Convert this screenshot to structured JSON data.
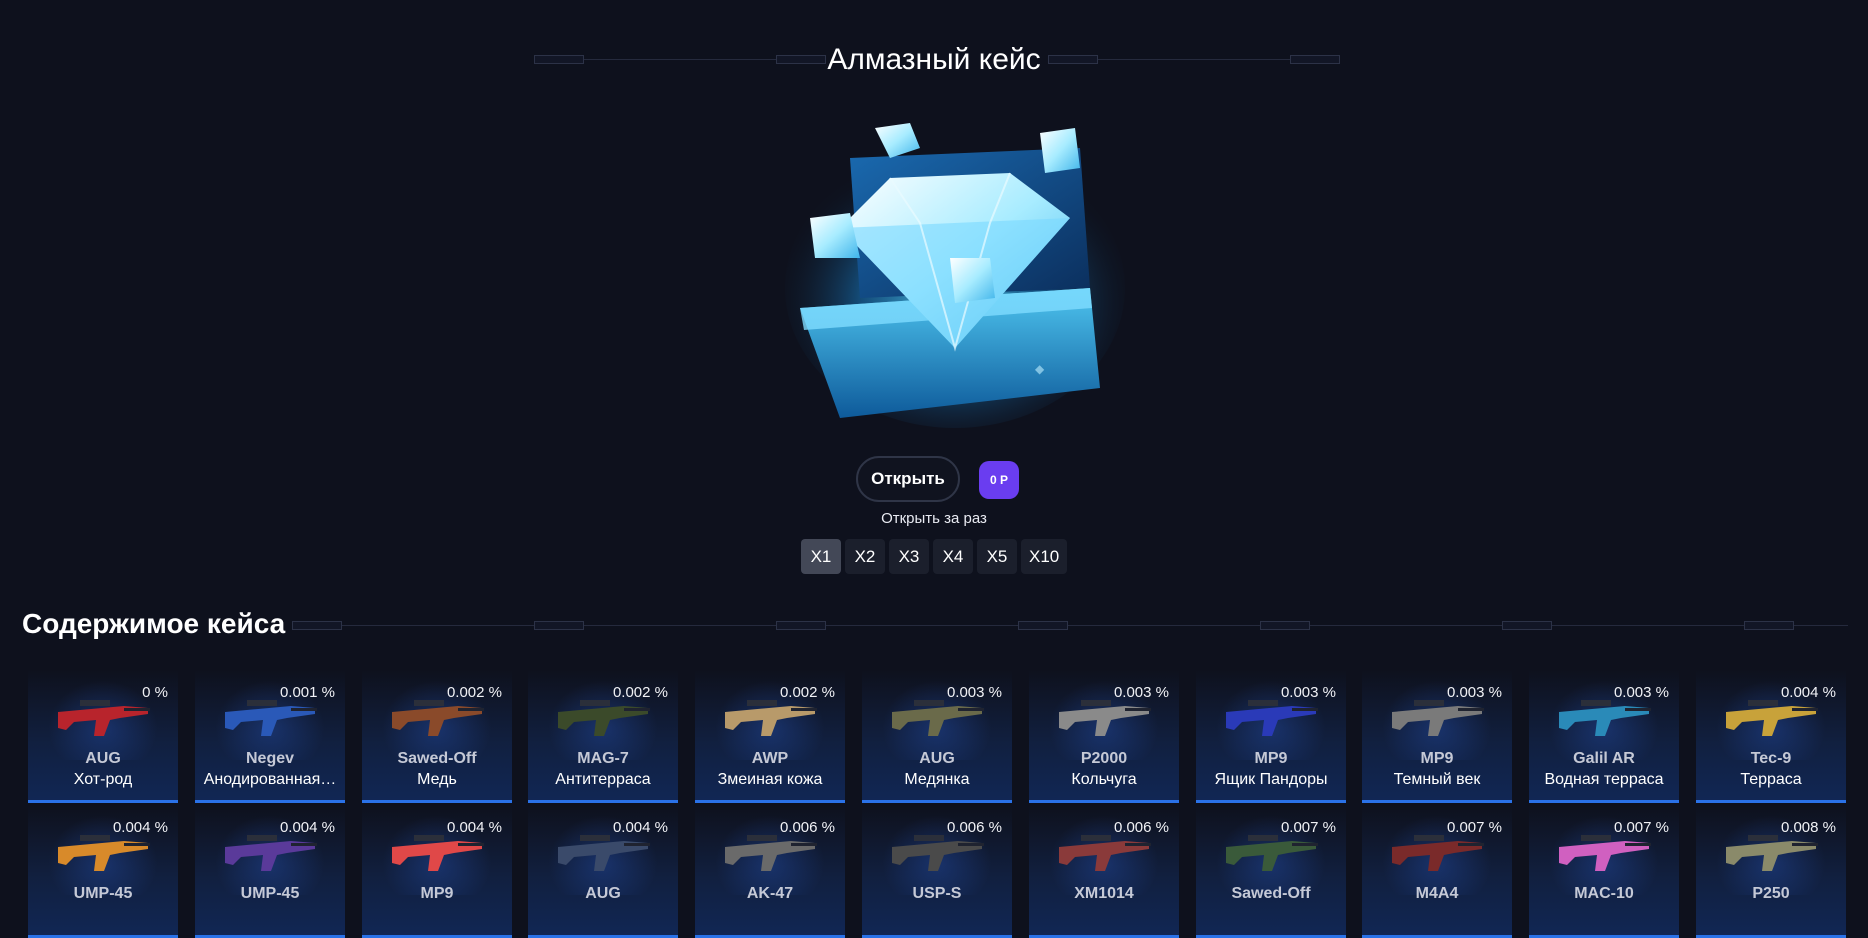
{
  "case": {
    "title": "Алмазный кейс",
    "open_label": "Открыть",
    "price_label": "0 Р",
    "open_times_label": "Открыть за раз",
    "multipliers": [
      "X1",
      "X2",
      "X3",
      "X4",
      "X5",
      "X10"
    ],
    "selected_multiplier": "X1"
  },
  "contents": {
    "title": "Содержимое кейса",
    "items": [
      {
        "weapon": "AUG",
        "skin": "Хот-род",
        "chance": "0 %",
        "color": "#b8242c"
      },
      {
        "weapon": "Negev",
        "skin": "Анодированная…",
        "chance": "0.001 %",
        "color": "#2a59b8"
      },
      {
        "weapon": "Sawed-Off",
        "skin": "Медь",
        "chance": "0.002 %",
        "color": "#8a4a2a"
      },
      {
        "weapon": "MAG-7",
        "skin": "Антитерраса",
        "chance": "0.002 %",
        "color": "#3b4a2a"
      },
      {
        "weapon": "AWP",
        "skin": "Змеиная кожа",
        "chance": "0.002 %",
        "color": "#b89a6a"
      },
      {
        "weapon": "AUG",
        "skin": "Медянка",
        "chance": "0.003 %",
        "color": "#6a6a4a"
      },
      {
        "weapon": "P2000",
        "skin": "Кольчуга",
        "chance": "0.003 %",
        "color": "#8a8a8a"
      },
      {
        "weapon": "MP9",
        "skin": "Ящик Пандоры",
        "chance": "0.003 %",
        "color": "#2a3ab8"
      },
      {
        "weapon": "MP9",
        "skin": "Темный век",
        "chance": "0.003 %",
        "color": "#7a7a7a"
      },
      {
        "weapon": "Galil AR",
        "skin": "Водная терраса",
        "chance": "0.003 %",
        "color": "#2a8ab8"
      },
      {
        "weapon": "Tec-9",
        "skin": "Терраса",
        "chance": "0.004 %",
        "color": "#c8a23a"
      },
      {
        "weapon": "UMP-45",
        "skin": "",
        "chance": "0.004 %",
        "color": "#d88a2a"
      },
      {
        "weapon": "UMP-45",
        "skin": "",
        "chance": "0.004 %",
        "color": "#5a3a9a"
      },
      {
        "weapon": "MP9",
        "skin": "",
        "chance": "0.004 %",
        "color": "#e04848"
      },
      {
        "weapon": "AUG",
        "skin": "",
        "chance": "0.004 %",
        "color": "#3a4a6a"
      },
      {
        "weapon": "AK-47",
        "skin": "",
        "chance": "0.006 %",
        "color": "#6a6a6a"
      },
      {
        "weapon": "USP-S",
        "skin": "",
        "chance": "0.006 %",
        "color": "#4a4a4a"
      },
      {
        "weapon": "XM1014",
        "skin": "",
        "chance": "0.006 %",
        "color": "#8a3a3a"
      },
      {
        "weapon": "Sawed-Off",
        "skin": "",
        "chance": "0.007 %",
        "color": "#3a5a3a"
      },
      {
        "weapon": "M4A4",
        "skin": "",
        "chance": "0.007 %",
        "color": "#7a2a2a"
      },
      {
        "weapon": "MAC-10",
        "skin": "",
        "chance": "0.007 %",
        "color": "#d060c0"
      },
      {
        "weapon": "P250",
        "skin": "",
        "chance": "0.008 %",
        "color": "#8a8a6a"
      }
    ]
  }
}
